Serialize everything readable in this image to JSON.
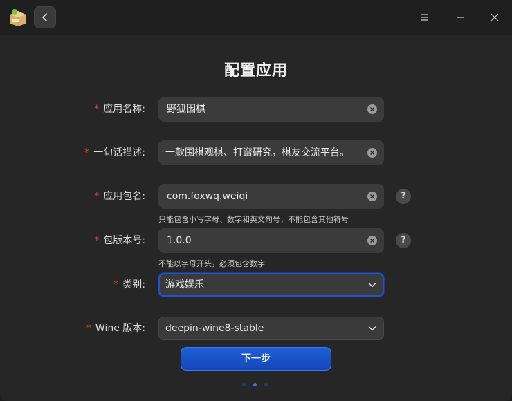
{
  "window": {
    "title": "配置应用",
    "app_icon": "package-box-icon",
    "controls": [
      "menu-icon",
      "minimize-icon",
      "close-icon"
    ]
  },
  "form": {
    "fields": [
      {
        "label": "应用名称:",
        "required": true,
        "value": "野狐围棋",
        "clearable": true,
        "help": false
      },
      {
        "label": "一句话描述:",
        "required": true,
        "value": "一款围棋观棋、打谱研究，棋友交流平台。",
        "clearable": true,
        "help": false
      },
      {
        "label": "应用包名:",
        "required": true,
        "value": "com.foxwq.weiqi",
        "clearable": true,
        "help": true,
        "hint": "只能包含小写字母、数字和英文句号，不能包含其他符号"
      },
      {
        "label": "包版本号:",
        "required": true,
        "value": "1.0.0",
        "clearable": true,
        "help": true,
        "hint": "不能以字母开头，必须包含数字"
      }
    ],
    "selects": [
      {
        "label": "类别:",
        "required": true,
        "value": "游戏娱乐",
        "focused": true
      },
      {
        "label": "Wine 版本:",
        "required": true,
        "value": "deepin-wine8-stable",
        "focused": false
      }
    ],
    "required_mark": "*",
    "help_glyph": "?"
  },
  "next_button": {
    "label": "下一步"
  },
  "pager": {
    "count": 3,
    "current": 2
  },
  "colors": {
    "accent": "#1f5ed8",
    "required": "#e0443c",
    "background": "#262627"
  }
}
